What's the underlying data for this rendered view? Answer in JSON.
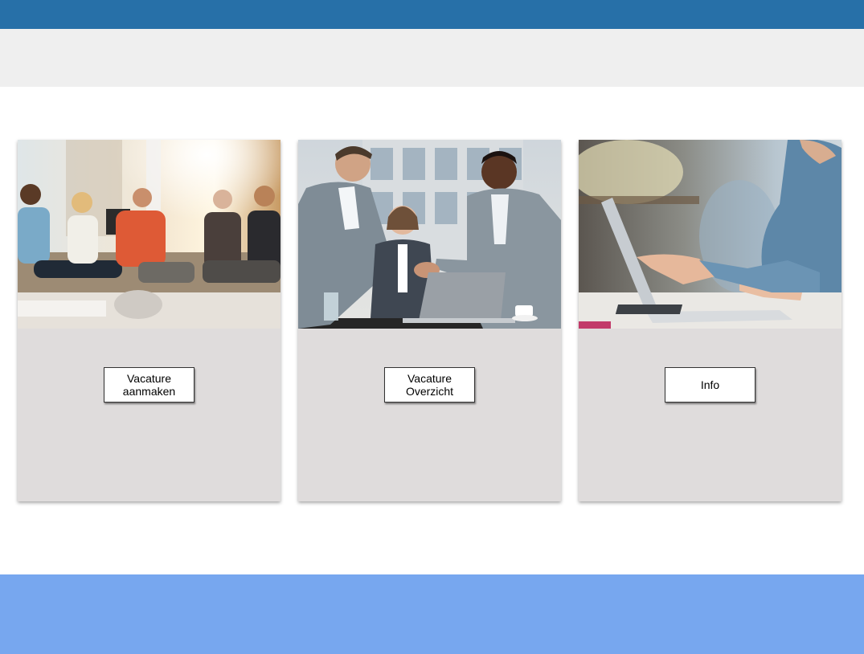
{
  "colors": {
    "topbar": "#2770a8",
    "subbar": "#efefef",
    "card_background": "#dfdcdc",
    "footer": "#77a7ef"
  },
  "cards": [
    {
      "image": "team-meeting-photo",
      "button_label": "Vacature aanmaken"
    },
    {
      "image": "business-handshake-photo",
      "button_label": "Vacature Overzicht"
    },
    {
      "image": "laptop-work-photo",
      "button_label": "Info"
    }
  ]
}
